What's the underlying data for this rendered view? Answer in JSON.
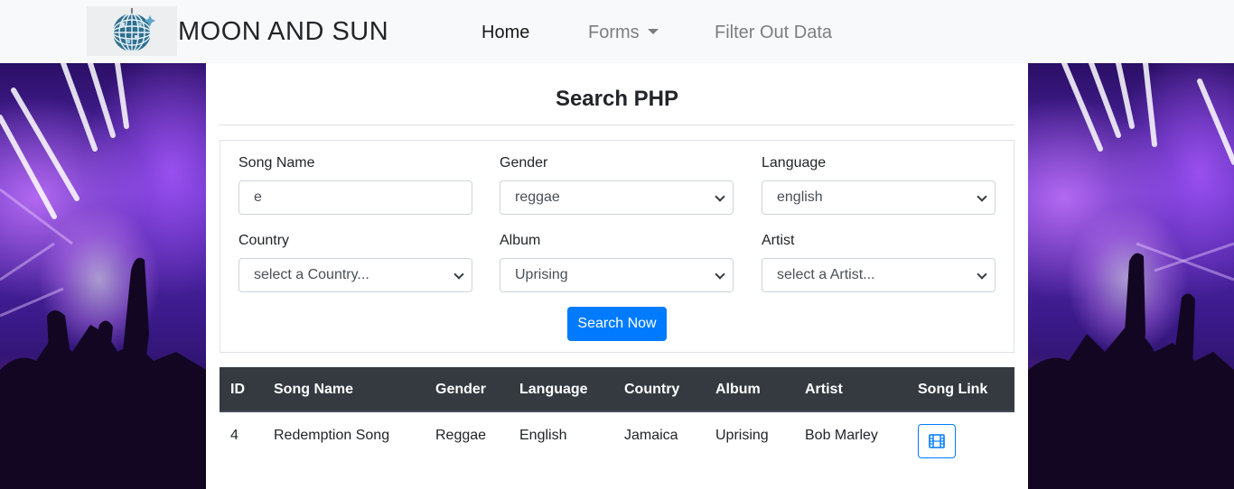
{
  "navbar": {
    "brand": "MOON AND SUN",
    "logo_icon": "disco-ball-icon",
    "links": [
      {
        "label": "Home",
        "active": true
      },
      {
        "label": "Forms",
        "dropdown": true
      },
      {
        "label": "Filter Out Data"
      }
    ]
  },
  "page": {
    "title": "Search PHP"
  },
  "form": {
    "song_name": {
      "label": "Song Name",
      "value": "e"
    },
    "gender": {
      "label": "Gender",
      "value": "reggae"
    },
    "language": {
      "label": "Language",
      "value": "english"
    },
    "country": {
      "label": "Country",
      "value": "select a Country..."
    },
    "album": {
      "label": "Album",
      "value": "Uprising"
    },
    "artist": {
      "label": "Artist",
      "value": "select a Artist..."
    },
    "submit_label": "Search Now"
  },
  "table": {
    "headers": [
      "ID",
      "Song Name",
      "Gender",
      "Language",
      "Country",
      "Album",
      "Artist",
      "Song Link"
    ],
    "rows": [
      {
        "id": "4",
        "song_name": "Redemption Song",
        "gender": "Reggae",
        "language": "English",
        "country": "Jamaica",
        "album": "Uprising",
        "artist": "Bob Marley",
        "link_icon": "film-icon"
      }
    ]
  },
  "colors": {
    "primary": "#007bff",
    "table_header": "#343a40",
    "navbar_bg": "#f8f9fa"
  }
}
